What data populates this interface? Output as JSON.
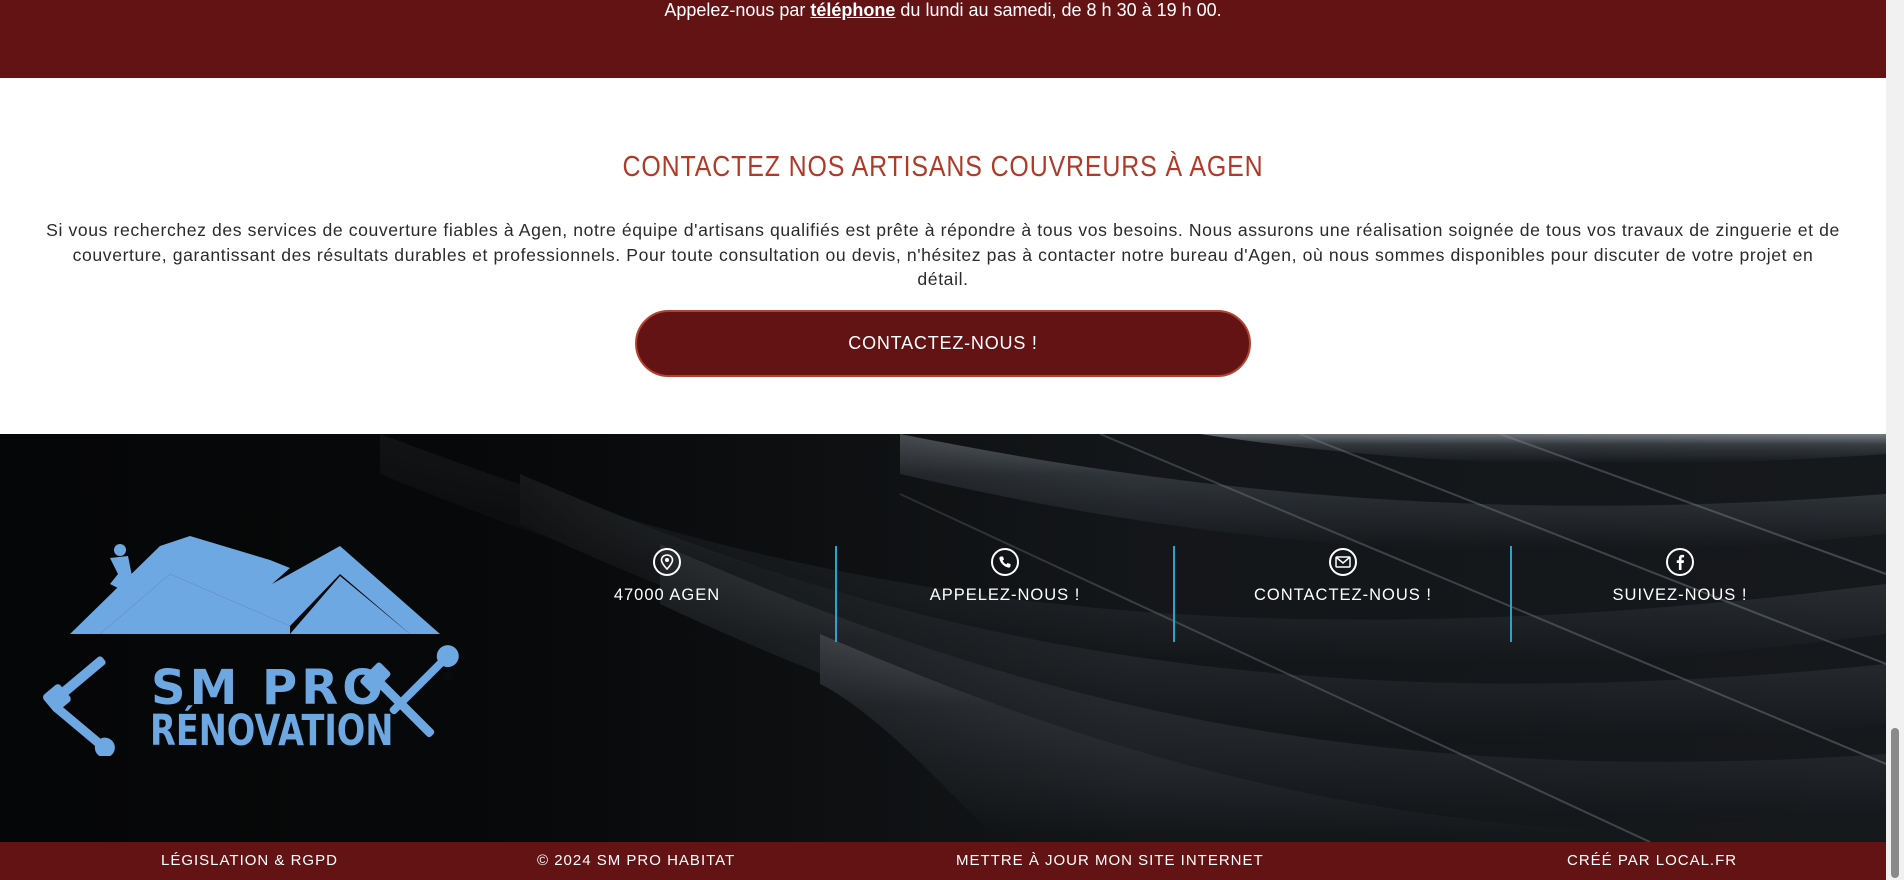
{
  "banner": {
    "text_before": "Appelez-nous par ",
    "link_label": "téléphone",
    "text_after": " du lundi au samedi, de 8 h 30 à 19 h 00."
  },
  "contact_section": {
    "title": "CONTACTEZ NOS ARTISANS COUVREURS À AGEN",
    "paragraph": "Si vous recherchez des services de couverture fiables à Agen, notre équipe d'artisans qualifiés est prête à répondre à tous vos besoins. Nous assurons une réalisation soignée de tous vos travaux de zinguerie et de couverture, garantissant des résultats durables et professionnels. Pour toute consultation ou devis, n'hésitez pas à contacter notre bureau d'Agen, où nous sommes disponibles pour discuter de votre projet en détail.",
    "cta_label": "CONTACTEZ-NOUS !"
  },
  "footer": {
    "logo": {
      "line1": "SM PRO",
      "line2": "RÉNOVATION"
    },
    "columns": [
      {
        "icon": "location-pin-icon",
        "label": "47000 AGEN"
      },
      {
        "icon": "phone-icon",
        "label": "APPELEZ-NOUS !"
      },
      {
        "icon": "envelope-icon",
        "label": "CONTACTEZ-NOUS !"
      },
      {
        "icon": "facebook-icon",
        "label": "SUIVEZ-NOUS !"
      }
    ]
  },
  "bottom_bar": {
    "legal": "LÉGISLATION & RGPD",
    "copyright": "© 2024 SM PRO HABITAT",
    "update": "METTRE À JOUR MON SITE INTERNET",
    "credit": "CRÉÉ PAR LOCAL.FR"
  },
  "colors": {
    "brand_dark_red": "#631314",
    "title_red": "#b03a28",
    "logo_blue": "#6ea8e2",
    "divider_cyan": "#29a3d4"
  }
}
